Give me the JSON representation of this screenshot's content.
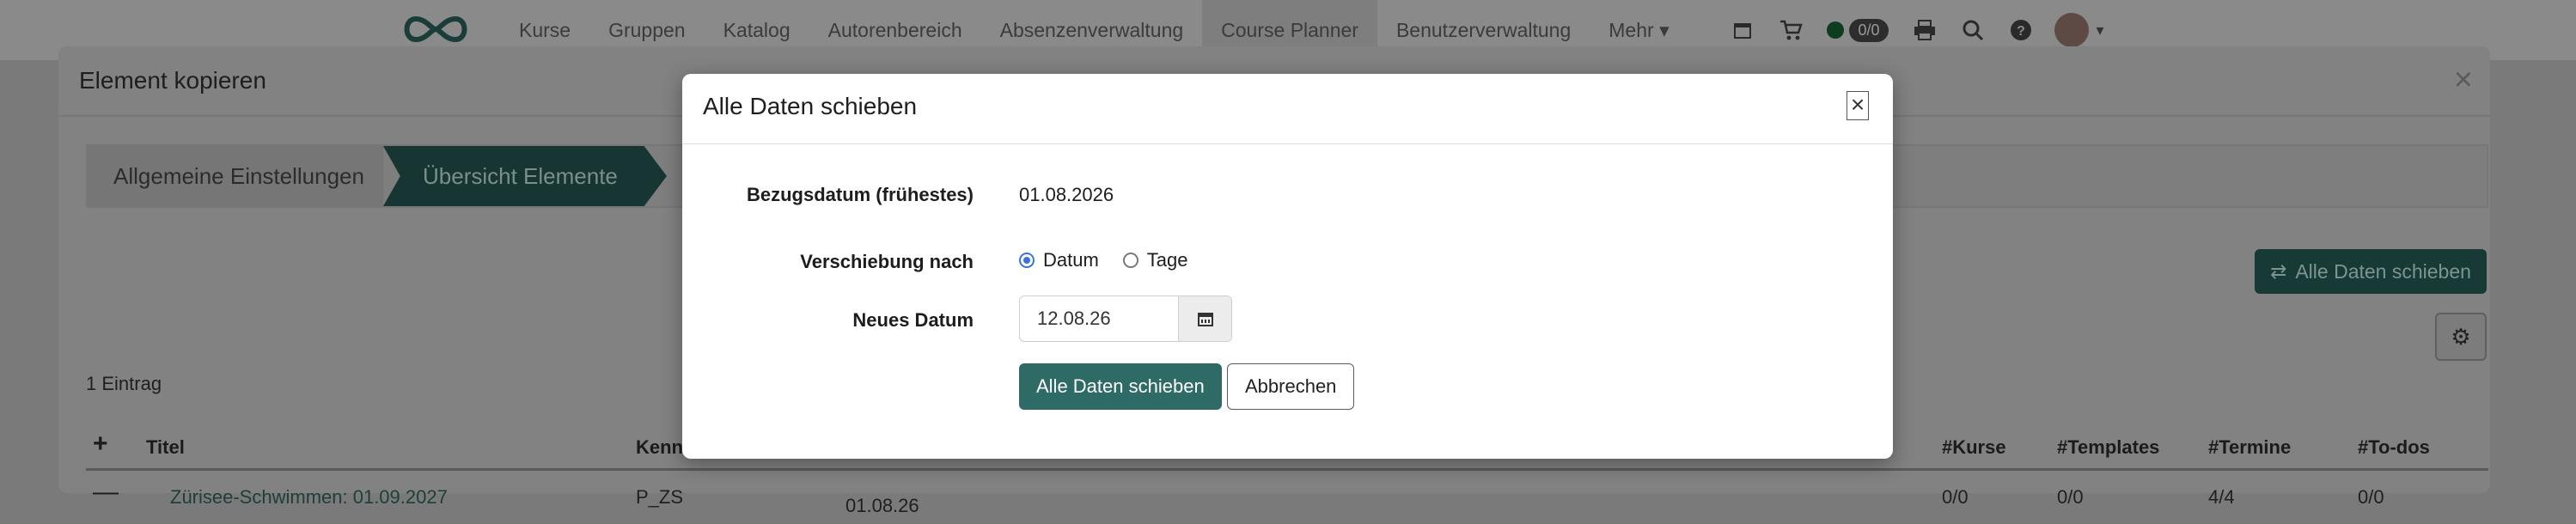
{
  "topnav": {
    "items": [
      "Kurse",
      "Gruppen",
      "Katalog",
      "Autorenbereich",
      "Absenzenverwaltung",
      "Course Planner",
      "Benutzerverwaltung",
      "Mehr"
    ],
    "badge": "0/0"
  },
  "panel": {
    "title": "Element kopieren",
    "wizard": [
      "Allgemeine Einstellungen",
      "Übersicht Elemente"
    ],
    "shift_button": "Alle Daten schieben",
    "count": "1 Eintrag",
    "columns": [
      "Titel",
      "Kenn",
      "#Kurse",
      "#Templates",
      "#Termine",
      "#To-dos"
    ],
    "row": {
      "title": "Zürisee-Schwimmen: 01.09.2027",
      "kenn": "P_ZS",
      "date": "01.08.26",
      "kurse": "0/0",
      "templates": "0/0",
      "termine": "4/4",
      "todos": "0/0"
    }
  },
  "modal": {
    "title": "Alle Daten schieben",
    "close_label": "×",
    "ref_label": "Bezugsdatum (frühestes)",
    "ref_value": "01.08.2026",
    "shift_label": "Verschiebung nach",
    "option_date": "Datum",
    "option_days": "Tage",
    "new_date_label": "Neues Datum",
    "new_date_value": "12.08.26",
    "primary_button": "Alle Daten schieben",
    "cancel_button": "Abbrechen"
  },
  "colors": {
    "primary": "#2e6b66",
    "radio_accent": "#3b74d6"
  }
}
